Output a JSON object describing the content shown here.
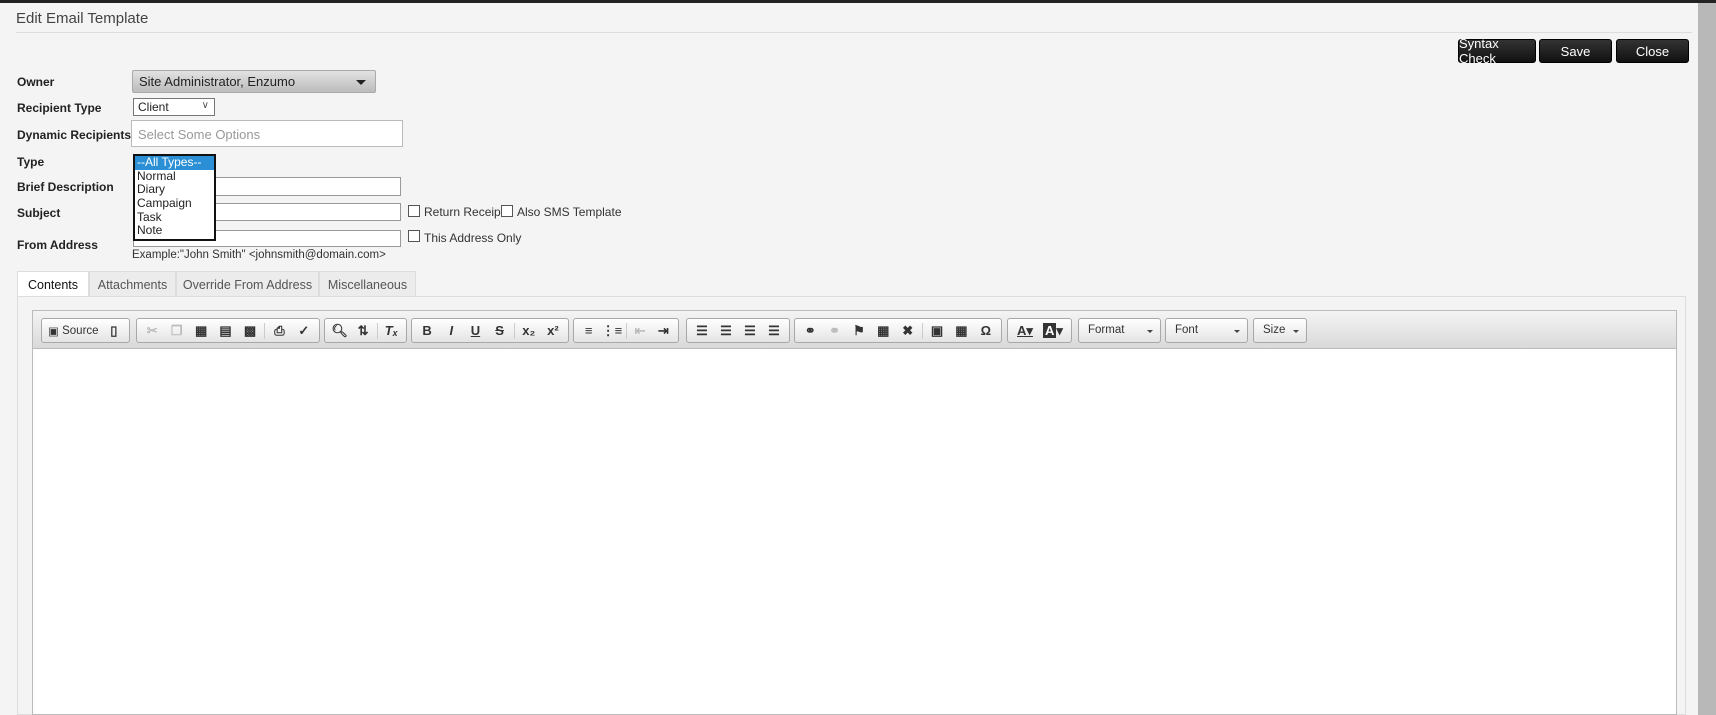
{
  "header": {
    "title": "Edit Email Template"
  },
  "actions": {
    "syntax_check": "Syntax Check",
    "save": "Save",
    "close": "Close"
  },
  "form": {
    "owner": {
      "label": "Owner",
      "value": "Site Administrator, Enzumo"
    },
    "recipient_type": {
      "label": "Recipient Type",
      "value": "Client"
    },
    "dynamic_recipients": {
      "label": "Dynamic Recipients",
      "placeholder": "Select Some Options"
    },
    "type": {
      "label": "Type",
      "options": [
        "--All Types--",
        "Normal",
        "Diary",
        "Campaign",
        "Task",
        "Note"
      ],
      "selected": "--All Types--"
    },
    "brief_description": {
      "label": "Brief Description",
      "value": ""
    },
    "subject": {
      "label": "Subject",
      "value": "",
      "return_receipt": "Return Receipt",
      "also_sms": "Also SMS Template"
    },
    "from_address": {
      "label": "From Address",
      "value": "",
      "this_address_only": "This Address Only",
      "example": "Example:\"John Smith\" <johnsmith@domain.com>"
    }
  },
  "tabs": [
    {
      "label": "Contents",
      "active": true
    },
    {
      "label": "Attachments"
    },
    {
      "label": "Override From Address"
    },
    {
      "label": "Miscellaneous"
    }
  ],
  "editor": {
    "source_label": "Source",
    "format": "Format",
    "font": "Font",
    "size": "Size"
  },
  "colors": {
    "button_bg": "#1a1a1a",
    "selection": "#2a8fd4",
    "background": "#f4f4f4"
  }
}
